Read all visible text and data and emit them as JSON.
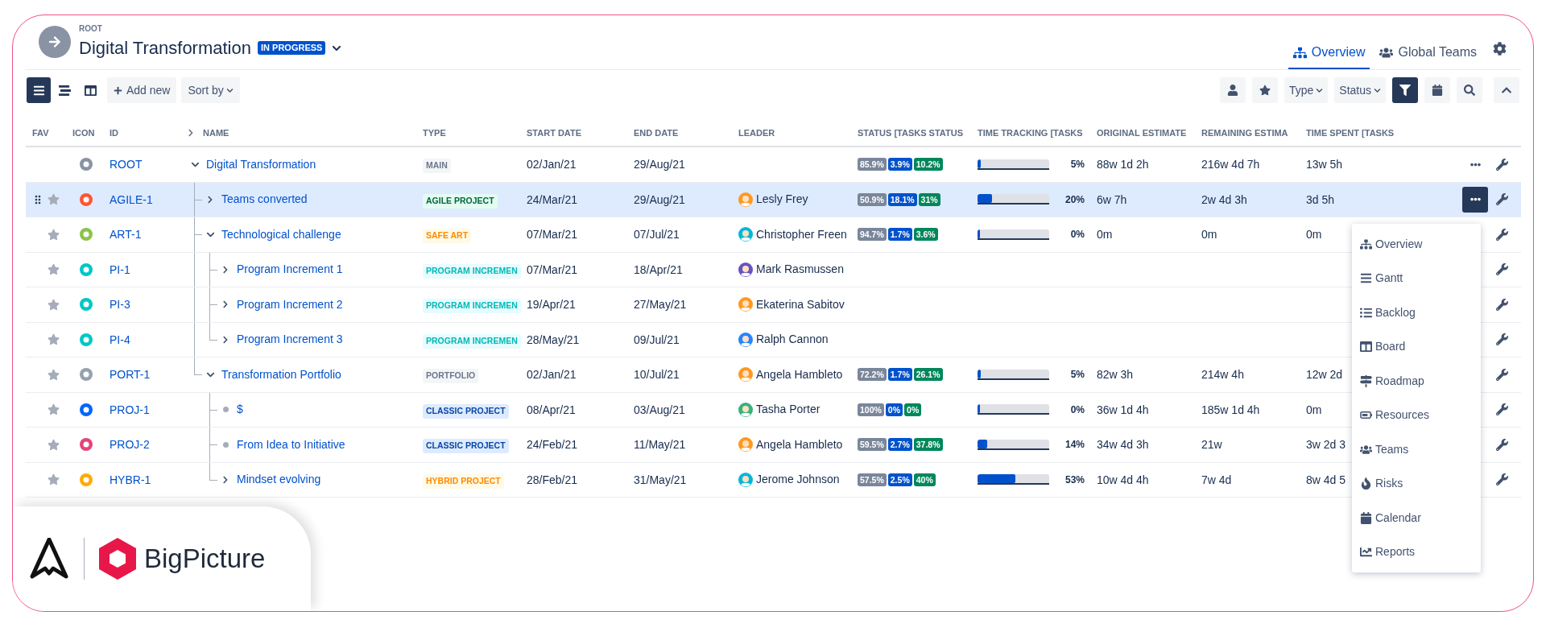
{
  "header": {
    "breadcrumb": "ROOT",
    "title": "Digital Transformation",
    "status_badge": "IN PROGRESS",
    "tabs": [
      {
        "label": "Overview",
        "selected": true
      },
      {
        "label": "Global Teams",
        "selected": false
      }
    ]
  },
  "toolbar": {
    "views": [
      {
        "selected": true
      },
      {
        "selected": false
      },
      {
        "selected": false
      }
    ],
    "add_label": "Add new",
    "sort_label": "Sort by",
    "tools": [
      {
        "kind": "button",
        "selected": false
      },
      {
        "kind": "button",
        "selected": false
      },
      {
        "kind": "dropdown",
        "label": "Type"
      },
      {
        "kind": "dropdown",
        "label": "Status"
      },
      {
        "kind": "button",
        "selected": true
      },
      {
        "kind": "button",
        "selected": false
      },
      {
        "kind": "button",
        "selected": false
      },
      {
        "kind": "button",
        "selected": false
      }
    ]
  },
  "table": {
    "columns": [
      "FAV",
      "ICON",
      "ID",
      "NAME",
      "TYPE",
      "START DATE",
      "END DATE",
      "LEADER",
      "STATUS [TASKS STATUS",
      "TIME TRACKING [TASKS",
      "ORIGINAL ESTIMATE",
      "REMAINING ESTIMA",
      "TIME SPENT [TASKS"
    ],
    "rows": [
      {
        "id": "ROOT",
        "name": "Digital Transformation",
        "icon": {
          "color": "#8993a4"
        },
        "type": {
          "label": "MAIN",
          "kind": "main"
        },
        "start": "02/Jan/21",
        "end": "29/Aug/21",
        "status": [
          "85.9%",
          "3.9%",
          "10.2%"
        ],
        "tracking": {
          "level": 0.05,
          "reading": "5%"
        },
        "original": "88w 1d 2h",
        "remaining": "216w 4d 7h",
        "spent": "13w 5h",
        "expanded": true,
        "selected": false,
        "more": {
          "open": false
        },
        "children": [
          {
            "id": "AGILE-1",
            "name": "Teams converted",
            "favorite": false,
            "icon": {
              "color": "#ff5630"
            },
            "type": {
              "label": "AGILE PROJECT",
              "kind": "agile"
            },
            "start": "24/Mar/21",
            "end": "29/Aug/21",
            "leader": {
              "name": "Lesly Frey",
              "color": "#ff991f"
            },
            "status": [
              "50.9%",
              "18.1%",
              "31%"
            ],
            "tracking": {
              "level": 0.2,
              "reading": "20%"
            },
            "original": "6w 7h",
            "remaining": "2w 4d 3h",
            "spent": "3d 5h",
            "expanded": false,
            "selected": true,
            "more": {
              "open": true
            }
          },
          {
            "id": "ART-1",
            "name": "Technological challenge",
            "favorite": false,
            "icon": {
              "color": "#8bc34a"
            },
            "type": {
              "label": "SAFE ART",
              "kind": "safe"
            },
            "start": "07/Mar/21",
            "end": "07/Jul/21",
            "leader": {
              "name": "Christopher Freen",
              "color": "#00b8d9"
            },
            "status": [
              "94.7%",
              "1.7%",
              "3.6%"
            ],
            "tracking": {
              "level": 0,
              "reading": "0%"
            },
            "original": "0m",
            "remaining": "0m",
            "spent": "0m",
            "expanded": true,
            "selected": false,
            "children": [
              {
                "id": "PI-1",
                "name": "Program Increment 1",
                "favorite": false,
                "icon": {
                  "color": "#00c7c7"
                },
                "type": {
                  "label": "PROGRAM INCREMEN",
                  "kind": "program"
                },
                "start": "07/Mar/21",
                "end": "18/Apr/21",
                "leader": {
                  "name": "Mark Rasmussen",
                  "color": "#6554c0"
                },
                "expanded": false,
                "selected": false
              },
              {
                "id": "PI-3",
                "name": "Program Increment 2",
                "favorite": false,
                "icon": {
                  "color": "#00c7c7"
                },
                "type": {
                  "label": "PROGRAM INCREMEN",
                  "kind": "program"
                },
                "start": "19/Apr/21",
                "end": "27/May/21",
                "leader": {
                  "name": "Ekaterina Sabitov",
                  "color": "#ff991f"
                },
                "expanded": false,
                "selected": false
              },
              {
                "id": "PI-4",
                "name": "Program Increment 3",
                "favorite": false,
                "icon": {
                  "color": "#00c7c7"
                },
                "type": {
                  "label": "PROGRAM INCREMEN",
                  "kind": "program"
                },
                "start": "28/May/21",
                "end": "09/Jul/21",
                "leader": {
                  "name": "Ralph Cannon",
                  "color": "#2684ff"
                },
                "expanded": false,
                "selected": false
              }
            ]
          },
          {
            "id": "PORT-1",
            "name": "Transformation Portfolio",
            "favorite": false,
            "icon": {
              "color": "#97a0af"
            },
            "type": {
              "label": "PORTFOLIO",
              "kind": "portfolio"
            },
            "start": "02/Jan/21",
            "end": "10/Jul/21",
            "leader": {
              "name": "Angela Hambleto",
              "color": "#ff991f"
            },
            "status": [
              "72.2%",
              "1.7%",
              "26.1%"
            ],
            "tracking": {
              "level": 0.05,
              "reading": "5%"
            },
            "original": "82w 3h",
            "remaining": "214w 4h",
            "spent": "12w 2d",
            "expanded": true,
            "selected": false,
            "children": [
              {
                "id": "PROJ-1",
                "name": "$",
                "favorite": false,
                "icon": {
                  "color": "#0065ff"
                },
                "type": {
                  "label": "CLASSIC PROJECT",
                  "kind": "classic"
                },
                "start": "08/Apr/21",
                "end": "03/Aug/21",
                "leader": {
                  "name": "Tasha Porter",
                  "color": "#36b37e"
                },
                "status": [
                  "100%",
                  "0%",
                  "0%"
                ],
                "tracking": {
                  "level": 0,
                  "reading": "0%"
                },
                "original": "36w 1d 4h",
                "remaining": "185w 1d 4h",
                "spent": "0m",
                "selected": false
              },
              {
                "id": "PROJ-2",
                "name": "From Idea to Initiative",
                "favorite": false,
                "icon": {
                  "color": "#e2457a"
                },
                "type": {
                  "label": "CLASSIC PROJECT",
                  "kind": "classic"
                },
                "start": "24/Feb/21",
                "end": "11/May/21",
                "leader": {
                  "name": "Angela Hambleto",
                  "color": "#ff991f"
                },
                "status": [
                  "59.5%",
                  "2.7%",
                  "37.8%"
                ],
                "tracking": {
                  "level": 0.14,
                  "reading": "14%"
                },
                "original": "34w 4d 3h",
                "remaining": "21w",
                "spent": "3w 2d 3",
                "selected": false
              },
              {
                "id": "HYBR-1",
                "name": "Mindset evolving",
                "favorite": false,
                "icon": {
                  "color": "#ffab00"
                },
                "type": {
                  "label": "HYBRID PROJECT",
                  "kind": "hybrid"
                },
                "start": "28/Feb/21",
                "end": "31/May/21",
                "leader": {
                  "name": "Jerome Johnson",
                  "color": "#00b8d9"
                },
                "status": [
                  "57.5%",
                  "2.5%",
                  "40%"
                ],
                "tracking": {
                  "level": 0.53,
                  "reading": "53%"
                },
                "original": "10w 4d 4h",
                "remaining": "7w 4d",
                "spent": "8w 4d 5",
                "expanded": false,
                "selected": false
              }
            ]
          }
        ]
      }
    ]
  },
  "row_menu": {
    "items": [
      "Overview",
      "Gantt",
      "Backlog",
      "Board",
      "Roadmap",
      "Resources",
      "Teams",
      "Risks",
      "Calendar",
      "Reports"
    ]
  },
  "brand": {
    "name": "BigPicture"
  }
}
